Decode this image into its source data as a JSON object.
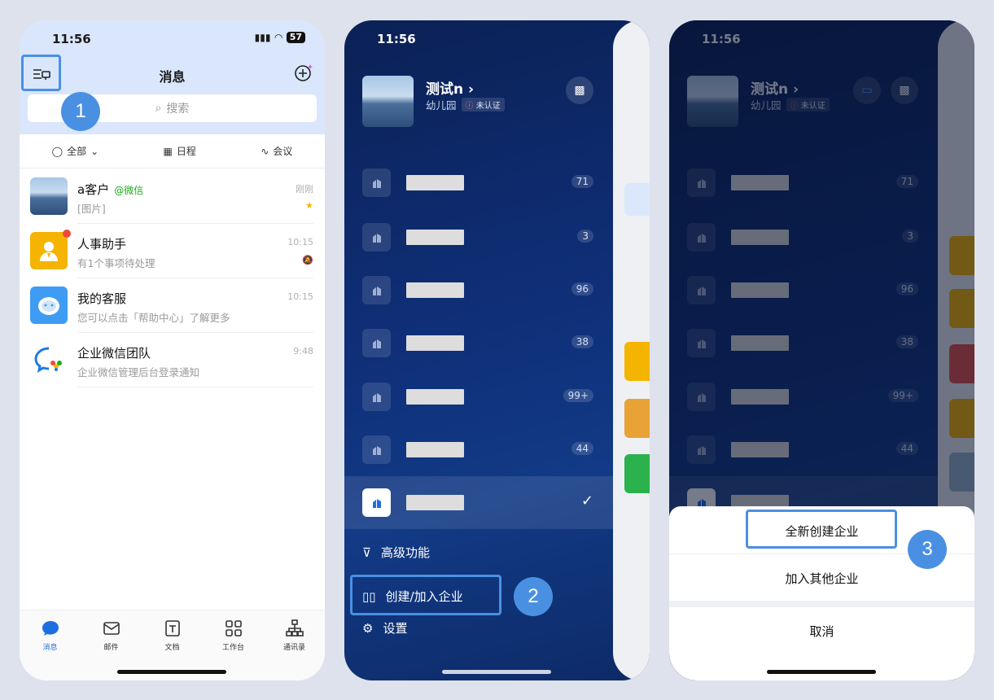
{
  "status": {
    "time": "11:56",
    "battery": "57"
  },
  "steps": [
    "1",
    "2",
    "3"
  ],
  "phone1": {
    "title": "消息",
    "search_placeholder": "搜索",
    "filters": [
      "全部",
      "日程",
      "会议"
    ],
    "chats": [
      {
        "name": "a客户",
        "tag": "@微信",
        "preview": "[图片]",
        "time": "刚刚",
        "starred": true
      },
      {
        "name": "人事助手",
        "tag": "",
        "preview": "有1个事项待处理",
        "time": "10:15",
        "muted": true
      },
      {
        "name": "我的客服",
        "tag": "",
        "preview": "您可以点击「帮助中心」了解更多",
        "time": "10:15"
      },
      {
        "name": "企业微信团队",
        "tag": "",
        "preview": "企业微信管理后台登录通知",
        "time": "9:48"
      }
    ],
    "tabs": [
      "消息",
      "邮件",
      "文档",
      "工作台",
      "通讯录"
    ]
  },
  "org": {
    "name": "测试n",
    "type": "幼儿园",
    "status": "未认证"
  },
  "org_counts": [
    "71",
    "3",
    "96",
    "38",
    "99+",
    "44"
  ],
  "drawer_menu": {
    "advanced": "高级功能",
    "create_join": "创建/加入企业",
    "settings": "设置"
  },
  "sheet": {
    "create_new": "全新创建企业",
    "join_other": "加入其他企业",
    "cancel": "取消"
  },
  "colors": {
    "highlight": "#4a90e2",
    "drawer_bg": "#0f2f78"
  }
}
